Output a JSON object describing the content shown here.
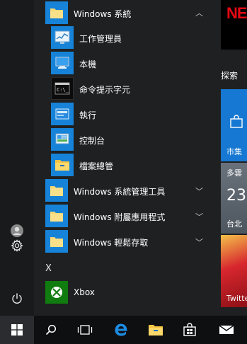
{
  "app_list": {
    "group_windows_system": {
      "label": "Windows 系統",
      "expanded": true
    },
    "items": [
      {
        "label": "工作管理員",
        "icon": "task-manager-icon"
      },
      {
        "label": "本機",
        "icon": "this-pc-icon"
      },
      {
        "label": "命令提示字元",
        "icon": "command-prompt-icon"
      },
      {
        "label": "執行",
        "icon": "run-icon"
      },
      {
        "label": "控制台",
        "icon": "control-panel-icon"
      },
      {
        "label": "檔案總管",
        "icon": "file-explorer-icon"
      }
    ],
    "groups": [
      {
        "label": "Windows 系統管理工具"
      },
      {
        "label": "Windows 附屬應用程式"
      },
      {
        "label": "Windows 輕鬆存取"
      }
    ],
    "letter_x": "X",
    "xbox": {
      "label": "Xbox",
      "color": "#107c10"
    }
  },
  "tiles": {
    "netflix": "NE",
    "section_title": "探索",
    "market": "市集",
    "weather": {
      "top": "多雲",
      "temp": "23°",
      "city": "台北"
    },
    "twitter": "Twitte"
  },
  "colors": {
    "accent": "#1683d8",
    "menu_bg": "#1f2021",
    "taskbar_bg": "#0e0f11"
  }
}
